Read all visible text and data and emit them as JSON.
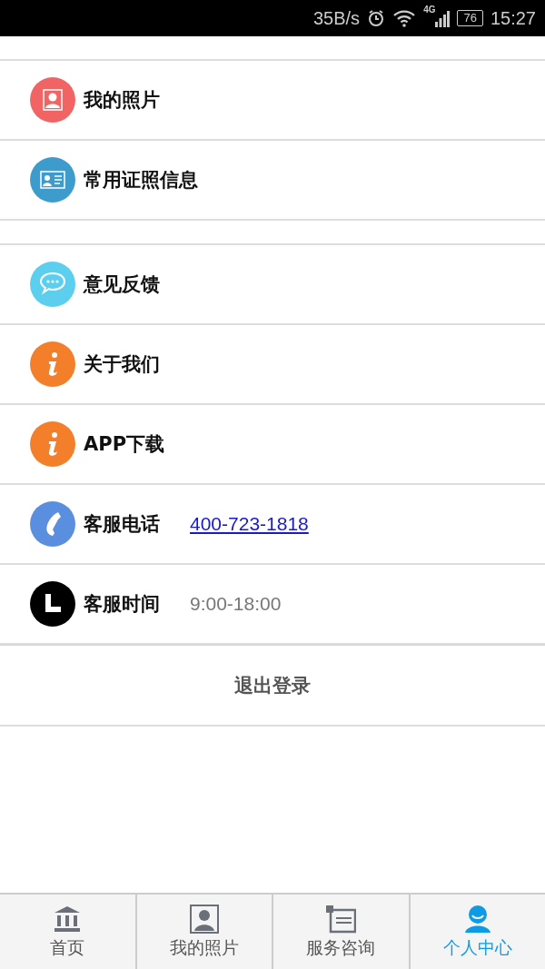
{
  "status_bar": {
    "speed": "35B/s",
    "network": "4G",
    "battery": "76",
    "time": "15:27"
  },
  "sections": [
    {
      "items": [
        {
          "label": "我的照片"
        },
        {
          "label": "常用证照信息"
        }
      ]
    },
    {
      "items": [
        {
          "label": "意见反馈"
        },
        {
          "label": "关于我们"
        },
        {
          "label": "APP下载"
        },
        {
          "label": "客服电话",
          "detail": {
            "kind": "link",
            "text": "400-723-1818"
          }
        },
        {
          "label": "客服时间",
          "detail": {
            "kind": "text",
            "text": "9:00-18:00"
          }
        }
      ]
    }
  ],
  "logout_button": "退出登录",
  "tabs": [
    {
      "label": "首页",
      "selected": false
    },
    {
      "label": "我的照片",
      "selected": false
    },
    {
      "label": "服务咨询",
      "selected": false
    },
    {
      "label": "个人中心",
      "selected": true
    }
  ]
}
